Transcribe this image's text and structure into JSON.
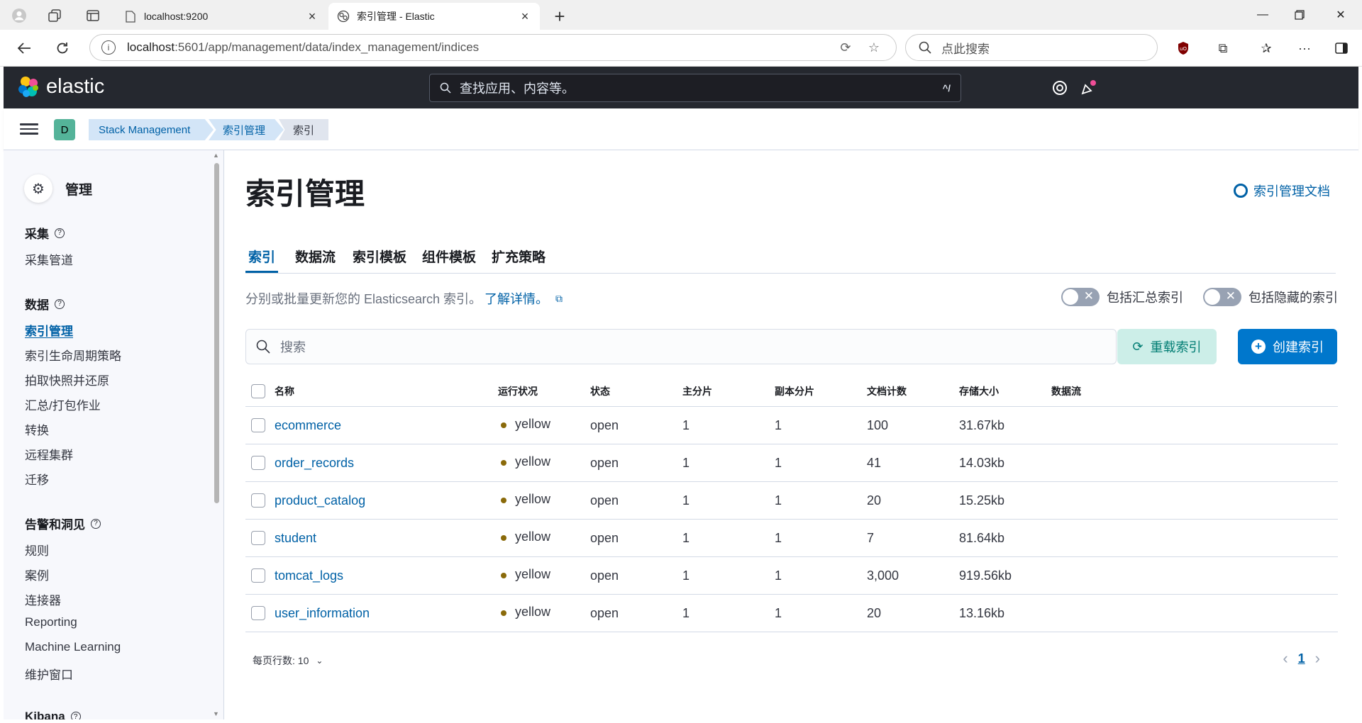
{
  "browser": {
    "tabs": [
      {
        "title": "localhost:9200"
      },
      {
        "title": "索引管理 - Elastic"
      }
    ],
    "url_host": "localhost",
    "url_path": ":5601/app/management/data/index_management/indices",
    "search_placeholder": "点此搜索"
  },
  "kibana": {
    "logo_text": "elastic",
    "search_placeholder": "查找应用、内容等。",
    "search_shortcut": "^/",
    "space_avatar": "D",
    "breadcrumbs": [
      "Stack Management",
      "索引管理",
      "索引"
    ]
  },
  "sidebar": {
    "title": "管理",
    "groups": [
      {
        "label": "采集",
        "items": [
          "采集管道"
        ]
      },
      {
        "label": "数据",
        "items": [
          "索引管理",
          "索引生命周期策略",
          "拍取快照并还原",
          "汇总/打包作业",
          "转换",
          "远程集群",
          "迁移"
        ]
      },
      {
        "label": "告警和洞见",
        "items": [
          "规则",
          "案例",
          "连接器",
          "Reporting",
          "Machine Learning",
          "维护窗口"
        ]
      },
      {
        "label": "Kibana",
        "items": []
      }
    ],
    "active_item": "索引管理"
  },
  "main": {
    "title": "索引管理",
    "docs_link": "索引管理文档",
    "tabs": [
      "索引",
      "数据流",
      "索引模板",
      "组件模板",
      "扩充策略"
    ],
    "selected_tab": "索引",
    "description": "分别或批量更新您的 Elasticsearch 索引。",
    "learn_more": "了解详情。",
    "toggle_rollup": "包括汇总索引",
    "toggle_hidden": "包括隐藏的索引",
    "search_placeholder": "搜索",
    "reload_button": "重载索引",
    "create_button": "创建索引",
    "columns": [
      "名称",
      "运行状况",
      "状态",
      "主分片",
      "副本分片",
      "文档计数",
      "存储大小",
      "数据流"
    ],
    "rows": [
      {
        "name": "ecommerce",
        "health": "yellow",
        "status": "open",
        "primary": "1",
        "replica": "1",
        "docs": "100",
        "size": "31.67kb",
        "stream": ""
      },
      {
        "name": "order_records",
        "health": "yellow",
        "status": "open",
        "primary": "1",
        "replica": "1",
        "docs": "41",
        "size": "14.03kb",
        "stream": ""
      },
      {
        "name": "product_catalog",
        "health": "yellow",
        "status": "open",
        "primary": "1",
        "replica": "1",
        "docs": "20",
        "size": "15.25kb",
        "stream": ""
      },
      {
        "name": "student",
        "health": "yellow",
        "status": "open",
        "primary": "1",
        "replica": "1",
        "docs": "7",
        "size": "81.64kb",
        "stream": ""
      },
      {
        "name": "tomcat_logs",
        "health": "yellow",
        "status": "open",
        "primary": "1",
        "replica": "1",
        "docs": "3,000",
        "size": "919.56kb",
        "stream": ""
      },
      {
        "name": "user_information",
        "health": "yellow",
        "status": "open",
        "primary": "1",
        "replica": "1",
        "docs": "20",
        "size": "13.16kb",
        "stream": ""
      }
    ],
    "rows_per_page": "每页行数: 10",
    "current_page": "1"
  },
  "colors": {
    "health_yellow": "#8a6a0a",
    "accent": "#0077cc",
    "link": "#0061a6"
  }
}
